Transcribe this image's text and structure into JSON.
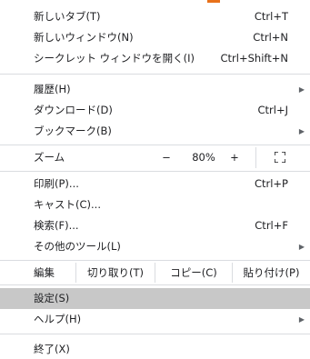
{
  "menu": {
    "new_tab": {
      "label": "新しいタブ(T)",
      "shortcut": "Ctrl+T"
    },
    "new_window": {
      "label": "新しいウィンドウ(N)",
      "shortcut": "Ctrl+N"
    },
    "new_incognito": {
      "label": "シークレット ウィンドウを開く(I)",
      "shortcut": "Ctrl+Shift+N"
    },
    "history": {
      "label": "履歴(H)"
    },
    "downloads": {
      "label": "ダウンロード(D)",
      "shortcut": "Ctrl+J"
    },
    "bookmarks": {
      "label": "ブックマーク(B)"
    },
    "zoom": {
      "label": "ズーム",
      "minus": "−",
      "value": "80%",
      "plus": "+"
    },
    "print": {
      "label": "印刷(P)...",
      "shortcut": "Ctrl+P"
    },
    "cast": {
      "label": "キャスト(C)..."
    },
    "find": {
      "label": "検索(F)...",
      "shortcut": "Ctrl+F"
    },
    "more_tools": {
      "label": "その他のツール(L)"
    },
    "edit": {
      "label": "編集",
      "cut": "切り取り(T)",
      "copy": "コピー(C)",
      "paste": "貼り付け(P)"
    },
    "settings": {
      "label": "設定(S)"
    },
    "help": {
      "label": "ヘルプ(H)"
    },
    "exit": {
      "label": "終了(X)"
    }
  },
  "colors": {
    "accent_strip": "#e8711a",
    "selected_background": "#c8c8c8",
    "separator": "#dadce0"
  },
  "icons": {
    "submenu": "triangle-right-icon",
    "fullscreen": "fullscreen-icon"
  }
}
